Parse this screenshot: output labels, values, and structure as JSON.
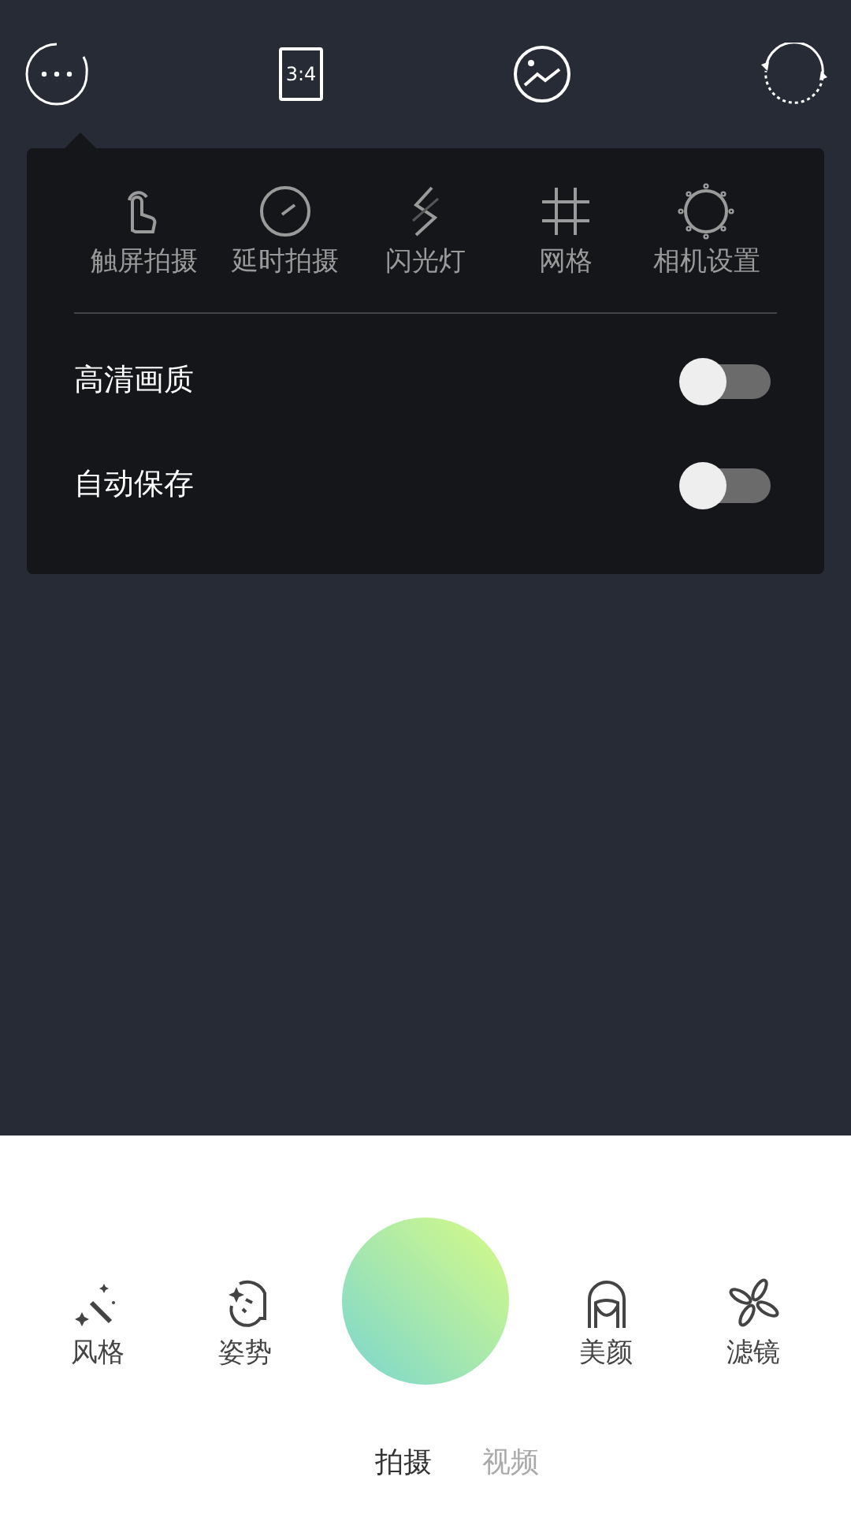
{
  "top_bar": {
    "ratio": "3:4"
  },
  "quick_menu": {
    "items": [
      {
        "kind": "touch",
        "label": "触屏拍摄"
      },
      {
        "kind": "timer",
        "label": "延时拍摄"
      },
      {
        "kind": "flash",
        "label": "闪光灯"
      },
      {
        "kind": "grid",
        "label": "网格"
      },
      {
        "kind": "settings",
        "label": "相机设置"
      }
    ],
    "toggles": [
      {
        "label": "高清画质",
        "on": false
      },
      {
        "label": "自动保存",
        "on": false
      }
    ]
  },
  "tools": [
    {
      "kind": "style",
      "label": "风格"
    },
    {
      "kind": "pose",
      "label": "姿势"
    },
    {
      "kind": "shutter"
    },
    {
      "kind": "beauty",
      "label": "美颜"
    },
    {
      "kind": "filter",
      "label": "滤镜"
    }
  ],
  "modes": [
    {
      "label": "拍摄",
      "selected": true
    },
    {
      "label": "视频",
      "selected": false
    }
  ]
}
